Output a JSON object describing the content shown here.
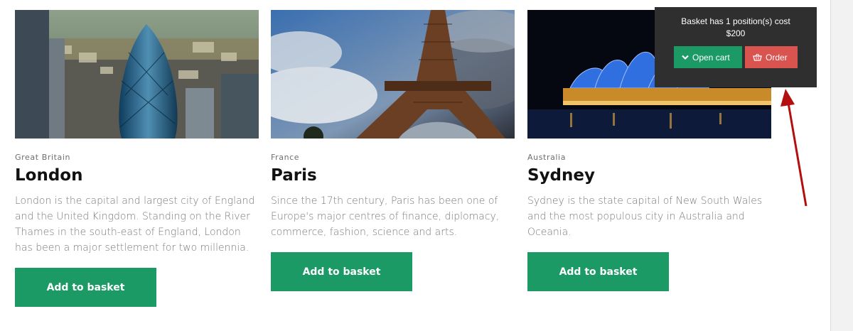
{
  "cards": [
    {
      "country": "Great Britain",
      "title": "London",
      "description": "London is the capital and largest city of England and the United Kingdom. Standing on the River Thames in the south-east of England, London has been a major settlement for two millennia.",
      "button_label": "Add to basket"
    },
    {
      "country": "France",
      "title": "Paris",
      "description": "Since the 17th century, Paris has been one of Europe's major centres of finance, diplomacy, commerce, fashion, science and arts.",
      "button_label": "Add to basket"
    },
    {
      "country": "Australia",
      "title": "Sydney",
      "description": "Sydney is the state capital of New South Wales and the most populous city in Australia and Oceania.",
      "button_label": "Add to basket"
    }
  ],
  "basket": {
    "line1": "Basket has 1 position(s) cost",
    "line2": "$200",
    "open_cart_label": "Open cart",
    "order_label": "Order"
  },
  "colors": {
    "accent_green": "#1b9a65",
    "order_red": "#d9534f",
    "popup_bg": "#2f2f2f",
    "annotation_arrow": "#b30f0f"
  },
  "icons": {
    "open_cart": "chevron-down-icon",
    "order": "basket-icon"
  }
}
